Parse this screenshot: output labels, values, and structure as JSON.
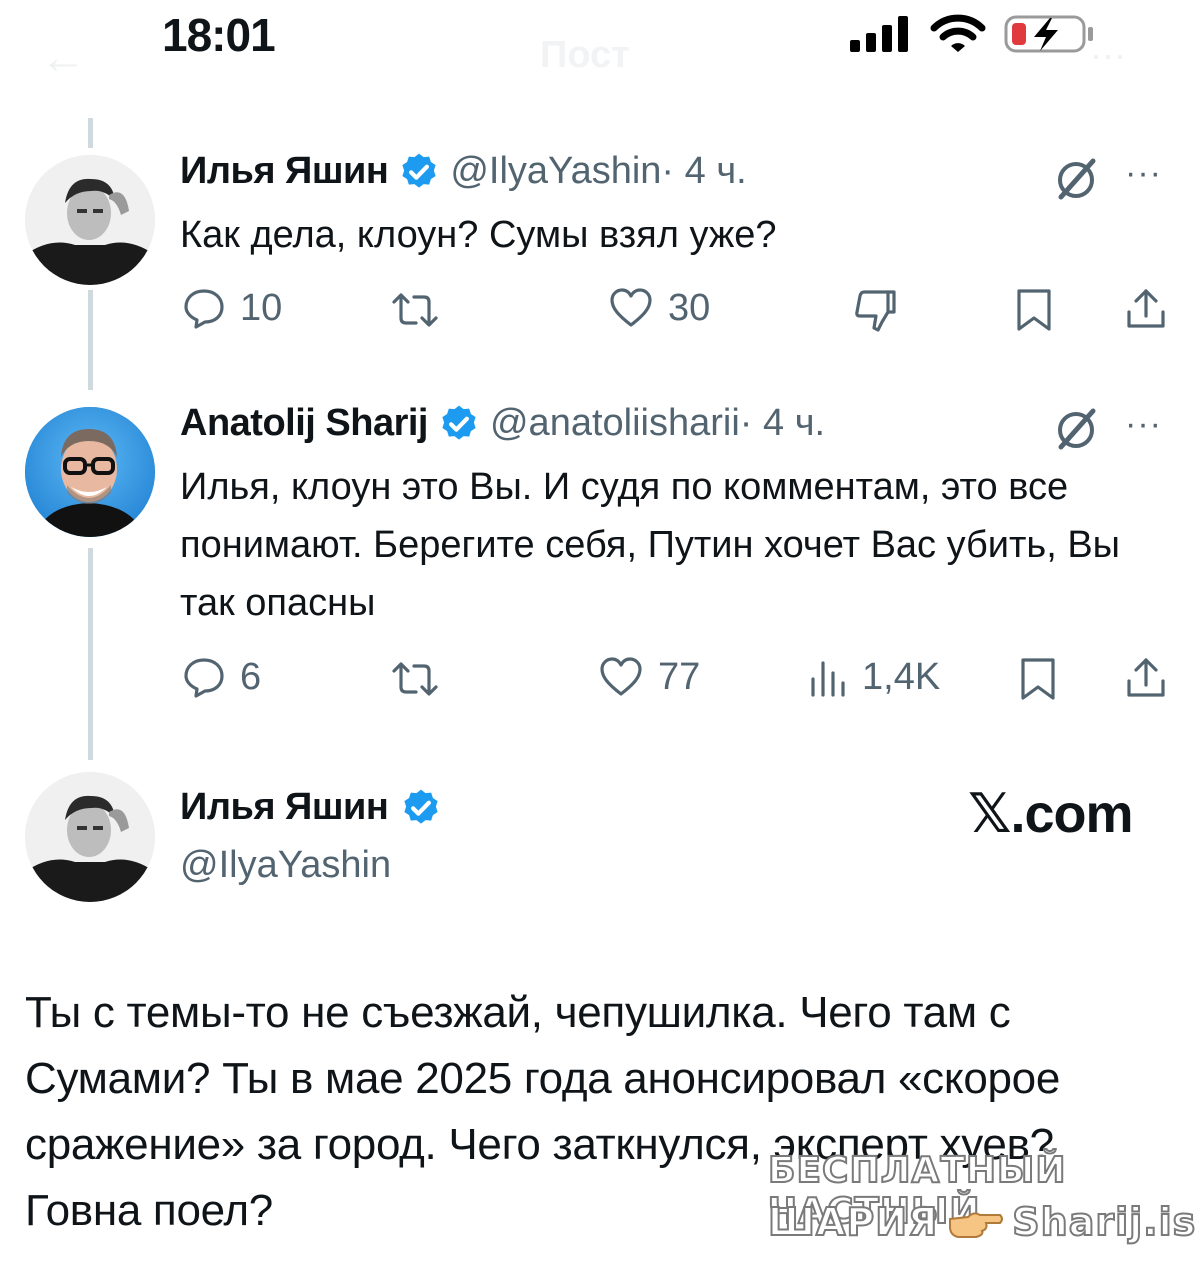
{
  "status_bar": {
    "time": "18:01"
  },
  "header_faded": {
    "back": "←",
    "title": "Пост",
    "more": "···"
  },
  "tweets": [
    {
      "name": "Илья Яшин",
      "handle": "@IlyaYashin",
      "time": " · 4 ч.",
      "text": "Как дела, клоун? Сумы взял уже?",
      "actions": {
        "replies": "10",
        "retweets": "",
        "likes": "30"
      }
    },
    {
      "name": "Anatolij Sharij",
      "handle": "@anatoliisharii",
      "time": " · 4 ч.",
      "text": "Илья, клоун это Вы. И судя по комментам, это все понимают. Берегите себя, Путин хочет Вас убить, Вы так опасны",
      "actions": {
        "replies": "6",
        "retweets": "",
        "likes": "77",
        "views": "1,4K"
      }
    }
  ],
  "main_post": {
    "name": "Илья Яшин",
    "handle": "@IlyaYashin",
    "site": "𝕏.com",
    "text": "Ты с темы-то не съезжай, чепушилка. Чего там с Сумами? Ты в мае 2025 года анонсировал «скорое сражение» за город. Чего заткнулся, эксперт хуев? Говна поел?"
  },
  "watermark": {
    "line1": "БЕСПЛАТНЫЙ ЧАСТНЫЙ",
    "line2_left": "ШАРИЯ",
    "line2_right": "Sharij.is"
  },
  "colors": {
    "verified": "#1d9bf0",
    "text": "#0f1419",
    "secondary": "#536471",
    "thread_line": "#cfd9de"
  }
}
